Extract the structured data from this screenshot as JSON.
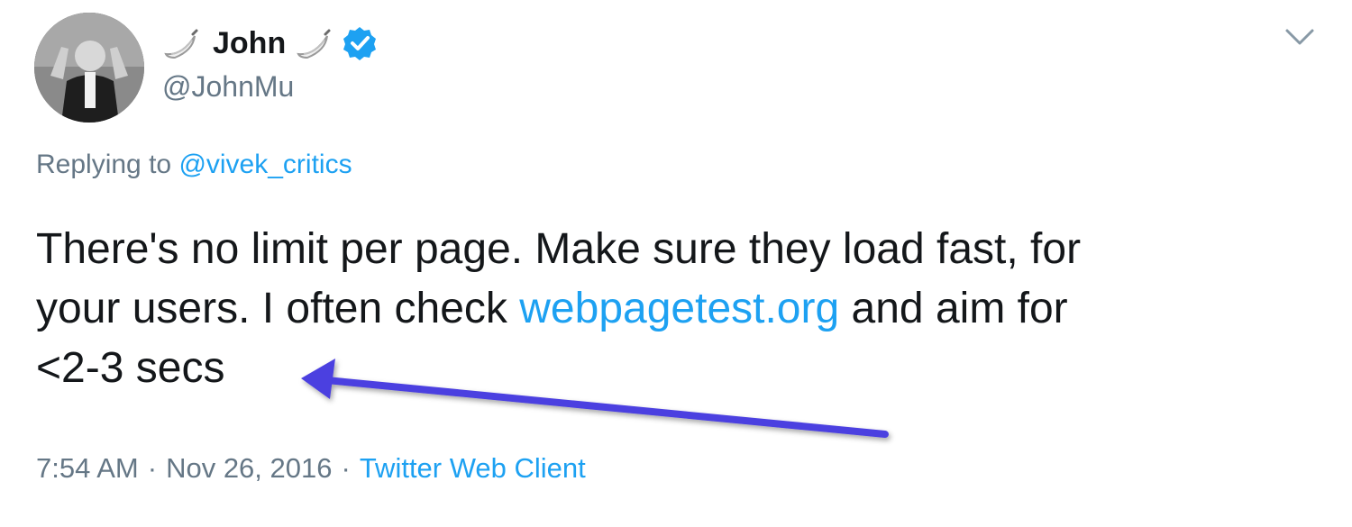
{
  "author": {
    "display_name": "John",
    "handle": "@JohnMu",
    "name_emoji": "banana-emoji",
    "verified_icon": "verified-badge-icon"
  },
  "reply": {
    "prefix": "Replying to",
    "mention": "@vivek_critics"
  },
  "tweet": {
    "line1": "There's no limit per page. Make sure they load fast, for",
    "line2_before": "your users. I often check",
    "line2_link": "webpagetest.org",
    "line2_after": "and aim for",
    "line3": "<2-3 secs"
  },
  "meta": {
    "time": "7:54 AM",
    "date": "Nov 26, 2016",
    "separator": "·",
    "client": "Twitter Web Client"
  },
  "colors": {
    "link": "#1da1f2",
    "text": "#14171a",
    "muted": "#657786",
    "annotation_arrow": "#4b3fe0"
  }
}
